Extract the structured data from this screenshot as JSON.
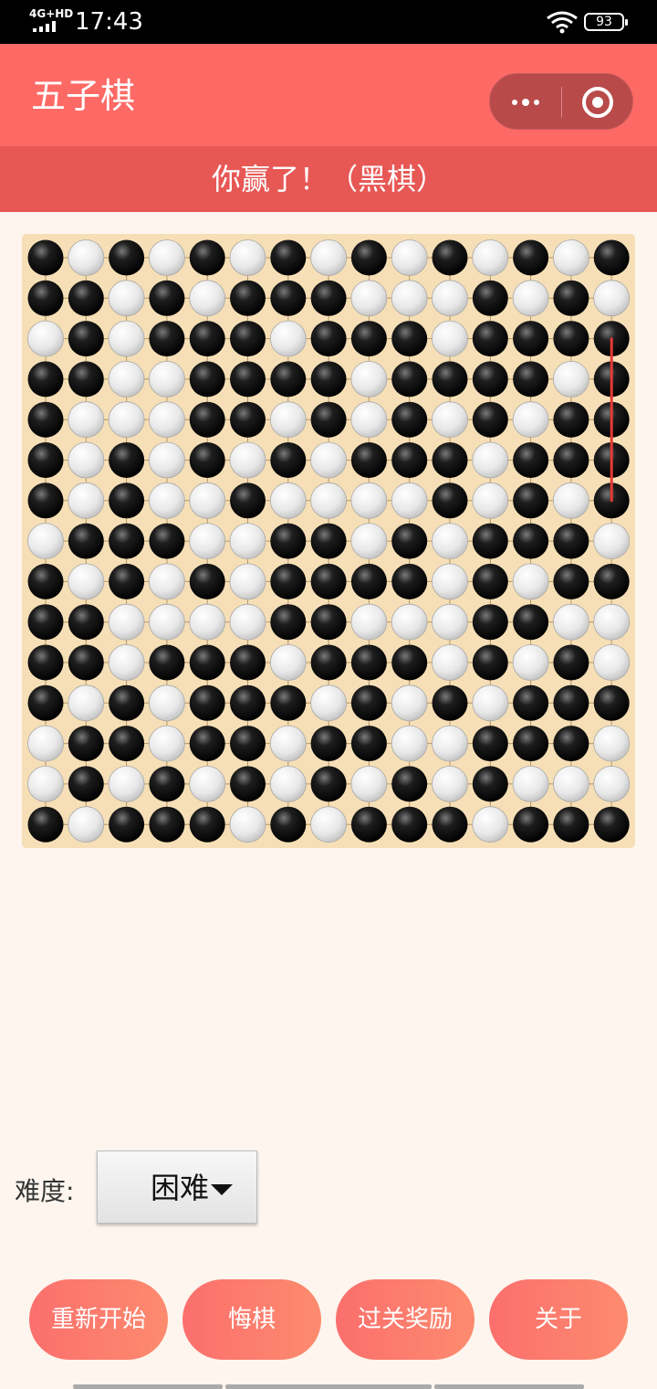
{
  "status_bar": {
    "network": "4G+HD",
    "time": "17:43",
    "battery": "93"
  },
  "header": {
    "title": "五子棋",
    "more_icon": "more-dots-icon",
    "close_icon": "target-circle-icon"
  },
  "banner": {
    "message": "你赢了！（黑棋）"
  },
  "board": {
    "size": 15,
    "legend": "B = black stone, W = white stone",
    "rows": [
      "BWBWBWBWBWBWBWB",
      "BBWBWBBBWWWBWBW",
      "WBWBBBWBBBWBBBB",
      "BBWWBBBBWBBBBWB",
      "BWWWBBWBWBWBWBB",
      "BWBWBWBWBBBWBBB",
      "BWBWWBWWWWBWBWB",
      "WBBBWWBBWBWBBBW",
      "BWBWBWBBBBWBWBB",
      "BBWWWWBBWWWBBWW",
      "BBWBBBWBBBWBWBW",
      "BWBWBBBWBWBWBBB",
      "WBBWBBWBBWWBBBW",
      "WBWBWBWBWBWBWWW",
      "BWBBBWBWBBBWBBB"
    ],
    "winning_line": {
      "from": [
        2,
        14
      ],
      "to": [
        6,
        14
      ],
      "color": "#e53935"
    },
    "colors": {
      "board": "#f6dfb6",
      "grid": "#b89463"
    }
  },
  "difficulty": {
    "label": "难度:",
    "value": "困难"
  },
  "buttons": {
    "restart": "重新开始",
    "undo": "悔棋",
    "reward": "过关奖励",
    "about": "关于"
  },
  "theme": {
    "primary": "#fd6a66",
    "banner": "#e75855",
    "background": "#fdf5ee"
  }
}
